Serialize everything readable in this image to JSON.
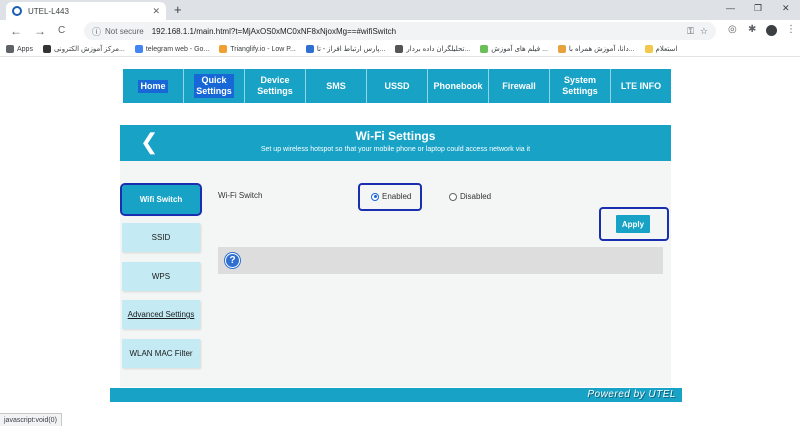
{
  "browser": {
    "tab_title": "UTEL-L443",
    "tab_close": "✕",
    "new_tab": "+",
    "win_minimize": "—",
    "win_maximize": "❐",
    "win_close": "✕",
    "nav_back": "←",
    "nav_forward": "→",
    "nav_reload": "C",
    "security_icon": "ⓘ",
    "security_text": "Not secure",
    "url": "192.168.1.1/main.html?t=MjAxOS0xMC0xNF8xNjoxMg==#wifiSwitch",
    "status_url": "javascript:void(0)"
  },
  "bookmarks": [
    {
      "label": "Apps",
      "color": "#5f6368"
    },
    {
      "label": "مرکز آموزش الکترونی...",
      "color": "#333333"
    },
    {
      "label": "telegram web - Go...",
      "color": "#4285f4"
    },
    {
      "label": "Trianglify.io - Low P...",
      "color": "#f0a030"
    },
    {
      "label": "پارس ارتباط افراز - تا...",
      "color": "#2f6fd0"
    },
    {
      "label": "تحلیلگران داده بردار...",
      "color": "#555555"
    },
    {
      "label": "فیلم های آموزش ...",
      "color": "#6bbf59"
    },
    {
      "label": "دانا، آموزش همراه با...",
      "color": "#e6a23c"
    },
    {
      "label": "استعلام",
      "color": "#f2c94c"
    }
  ],
  "topnav": [
    {
      "label": "Home",
      "highlight": true
    },
    {
      "label": "Quick\nSettings",
      "highlight": true
    },
    {
      "label": "Device\nSettings",
      "highlight": false
    },
    {
      "label": "SMS",
      "highlight": false
    },
    {
      "label": "USSD",
      "highlight": false
    },
    {
      "label": "Phonebook",
      "highlight": false
    },
    {
      "label": "Firewall",
      "highlight": false
    },
    {
      "label": "System\nSettings",
      "highlight": false
    },
    {
      "label": "LTE INFO",
      "highlight": false
    }
  ],
  "panel": {
    "back": "❮",
    "title": "Wi-Fi Settings",
    "subtitle": "Set up wireless hotspot so that your mobile phone or laptop could access network via it"
  },
  "sidebar": [
    {
      "label": "Wifi Switch",
      "active": true
    },
    {
      "label": "SSID",
      "active": false
    },
    {
      "label": "WPS",
      "active": false
    },
    {
      "label": "Advanced Settings",
      "active": false
    },
    {
      "label": "WLAN MAC Filter",
      "active": false
    }
  ],
  "form": {
    "field_label": "Wi-Fi Switch",
    "enabled_label": "Enabled",
    "disabled_label": "Disabled",
    "selected": "Enabled",
    "apply_label": "Apply",
    "help_icon": "?"
  },
  "footer": {
    "powered_by": "Powered by UTEL"
  },
  "colors": {
    "accent": "#17a2c6",
    "highlight_outline": "#1a2fb0",
    "sidebar_inactive": "#c4eaf3"
  }
}
